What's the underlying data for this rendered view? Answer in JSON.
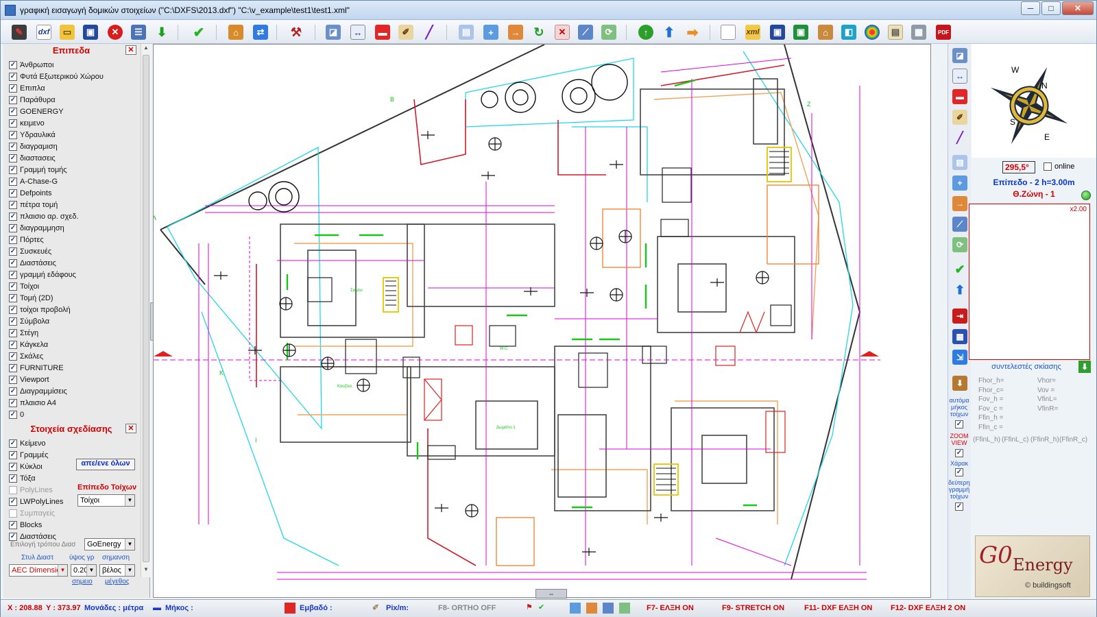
{
  "window": {
    "title": "γραφική εισαγωγή δομικών στοιχείων (\"C:\\DXFS\\2013.dxf\") \"C:\\v_example\\test1\\test1.xml\"",
    "btn_min": "─",
    "btn_max": "□",
    "btn_close": "✕"
  },
  "toolbar": {
    "dxf_label": "dxf",
    "xml_label": "xml",
    "pdf_label": "PDF"
  },
  "layers": {
    "title": "Επιπεδα",
    "items": [
      {
        "label": "Άνθρωποι",
        "checked": true
      },
      {
        "label": "Φυτά Εξωτερικού Χώρου",
        "checked": true
      },
      {
        "label": "Επιπλα",
        "checked": true
      },
      {
        "label": "Παράθυρα",
        "checked": true
      },
      {
        "label": "GOENERGY",
        "checked": true
      },
      {
        "label": "κειμενο",
        "checked": true
      },
      {
        "label": "Υδραυλικά",
        "checked": true
      },
      {
        "label": "διαγραμιση",
        "checked": true
      },
      {
        "label": "διαστασεις",
        "checked": true
      },
      {
        "label": "Γραμμή τομής",
        "checked": true
      },
      {
        "label": "A-Chase-G",
        "checked": true
      },
      {
        "label": "Defpoints",
        "checked": true
      },
      {
        "label": "πέτρα τομή",
        "checked": true
      },
      {
        "label": "πλαισιο αρ. σχεδ.",
        "checked": true
      },
      {
        "label": "διαγραμμηση",
        "checked": true
      },
      {
        "label": "Πόρτες",
        "checked": true
      },
      {
        "label": "Συσκευές",
        "checked": true
      },
      {
        "label": "Διαστάσεις",
        "checked": true
      },
      {
        "label": "γραμμή εδάφους",
        "checked": true
      },
      {
        "label": "Τοίχοι",
        "checked": true
      },
      {
        "label": "Τομή (2D)",
        "checked": true
      },
      {
        "label": "τοίχοι προβολή",
        "checked": true
      },
      {
        "label": "Σύμβολα",
        "checked": true
      },
      {
        "label": "Στέγη",
        "checked": true
      },
      {
        "label": "Κάγκελα",
        "checked": true
      },
      {
        "label": "Σκάλες",
        "checked": true
      },
      {
        "label": "FURNITURE",
        "checked": true
      },
      {
        "label": "Viewport",
        "checked": true
      },
      {
        "label": "Διαγραμμίσεις",
        "checked": true
      },
      {
        "label": "πλαισιο Α4",
        "checked": true
      },
      {
        "label": "0",
        "checked": true
      }
    ]
  },
  "drawing_elements": {
    "title": "Στοιχεία σχεδίασης",
    "items": [
      {
        "label": "Κείμενο",
        "checked": true,
        "enabled": true
      },
      {
        "label": "Γραμμές",
        "checked": true,
        "enabled": true
      },
      {
        "label": "Κύκλοι",
        "checked": true,
        "enabled": true
      },
      {
        "label": "Τόξα",
        "checked": true,
        "enabled": true
      },
      {
        "label": "PolyLines",
        "checked": false,
        "enabled": false
      },
      {
        "label": "LWPolyLines",
        "checked": true,
        "enabled": true
      },
      {
        "label": "Συμπαγείς",
        "checked": false,
        "enabled": false
      },
      {
        "label": "Blocks",
        "checked": true,
        "enabled": true
      },
      {
        "label": "Διαστάσεις",
        "checked": true,
        "enabled": true
      }
    ],
    "select_all_button": "απε/ενε όλων",
    "wall_level_label": "Επίπεδο Τοίχων",
    "wall_level_value": "Τοίχοι",
    "dim_method_label": "Επιλογή τρόπου Διασ",
    "dim_method_value": "GoEnergy",
    "dim_style_label": "Στυλ Διαστ",
    "text_height_label": "ύψος γρ",
    "marker_label": "σημανση",
    "dim_style_value": "AEC Dimensic",
    "text_height_value": "0.20",
    "marker_value": "βέλος",
    "point_label": "σημειο",
    "size_label": "μέγεθος"
  },
  "right_panel": {
    "angle": "295,5°",
    "online_label": "online",
    "level_text": "Επίπεδο - 2  h=3.00m",
    "zone_text": "Θ.Ζώνη - 1",
    "preview_scale": "x2.00",
    "compass": {
      "n": "N",
      "s": "S",
      "e": "E",
      "w": "W"
    },
    "shading_title": "συντελεστές σκίασης",
    "shading_left": [
      "Fhor_h=",
      "Fhor_c=",
      "Fov_h =",
      "Fov_c =",
      "Ffin_h =",
      "Ffin_c ="
    ],
    "shading_right": [
      "Vhor=",
      "Vov =",
      "VfinL=",
      "VfinR="
    ],
    "shading_bottom": [
      "(FfinL_h)",
      "(FfinL_c)",
      "(FfinR_h)",
      "(FfinR_c)"
    ],
    "logo_go": "G0",
    "logo_energy": "Energy",
    "logo_copy": "© buildingsoft"
  },
  "vertical_toolbar": {
    "auto_walls_label": "αυτόμα μήκος τοίχων",
    "zoom_view_label": "ZOOM VIEW",
    "map_label": "Χάρακ",
    "second_line_label": "δεύτερη γραμμή τοίχων"
  },
  "status": {
    "x": "X : 208.88",
    "y": "Y : 373.97",
    "units": "Μονάδες : μέτρα",
    "length": "Μήκος :",
    "area": "Εμβαδό :",
    "pix": "Pix/m:",
    "f8": "F8- ORTHO OFF",
    "f7": "F7- ΕΛΞΗ ON",
    "f9": "F9- STRETCH ON",
    "f11": "F11- DXF ΕΛΞΗ ON",
    "f12": "F12- DXF ΕΛΞΗ 2 ON"
  },
  "plan_labels": {
    "section_a": "A",
    "section_b": "B",
    "section_z": "Z",
    "section_k": "K",
    "section_i": "I",
    "kitchen": "Κουζίνα",
    "living": "Σαλόνι",
    "bedroom": "Δωμάτιο 1",
    "wc": "W.C."
  },
  "colors": {
    "accent_red": "#d40000",
    "link_blue": "#1d55c9",
    "plan_magenta": "#e000e0",
    "plan_cyan": "#1ed8e8",
    "plan_green": "#17c617",
    "plan_orange": "#f2a25a",
    "plan_red": "#e02020"
  }
}
